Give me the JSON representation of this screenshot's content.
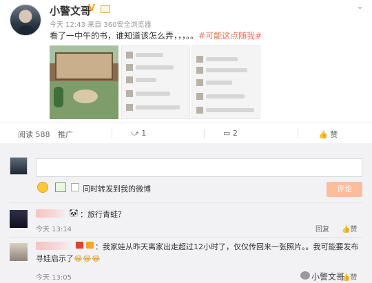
{
  "post": {
    "username": "小警文哥",
    "verified_mark": "V",
    "meta": "今天 12:43 来自 360安全浏览器",
    "text": "看了一中午的书，谁知道该怎么弄，，，。。",
    "hashtag": "#可能这点随我#"
  },
  "stats": {
    "views": "阅读 588",
    "promote": "推广",
    "reposts": "1",
    "comments": "2",
    "likes": "赞"
  },
  "composer": {
    "input_value": "",
    "repost_label": "同时转发到我的微博",
    "submit_label": "评论"
  },
  "comments": [
    {
      "text": "：旅行青蛙？",
      "time": "今天 13:14",
      "reply": "回复",
      "like": "赞"
    },
    {
      "text_line1": "：我家娃从昨天离家出走超过12小时了，仅仅传回来一张照片。。我可能要发布",
      "text_line2": "寻娃启示了",
      "laugh": "😂😂😂",
      "time": "今天 13:05",
      "reply": "回复",
      "like": "赞"
    }
  ],
  "watermark": "小警文哥",
  "colors": {
    "accent": "#eb7350",
    "submit": "#fbbd9b",
    "comment_bg": "#f2f2f5"
  },
  "icons": [
    "chevron-down-icon",
    "repost-icon",
    "comment-icon",
    "like-icon",
    "emoji-icon",
    "image-icon",
    "panda-icon",
    "laugh-emoji-icon"
  ]
}
